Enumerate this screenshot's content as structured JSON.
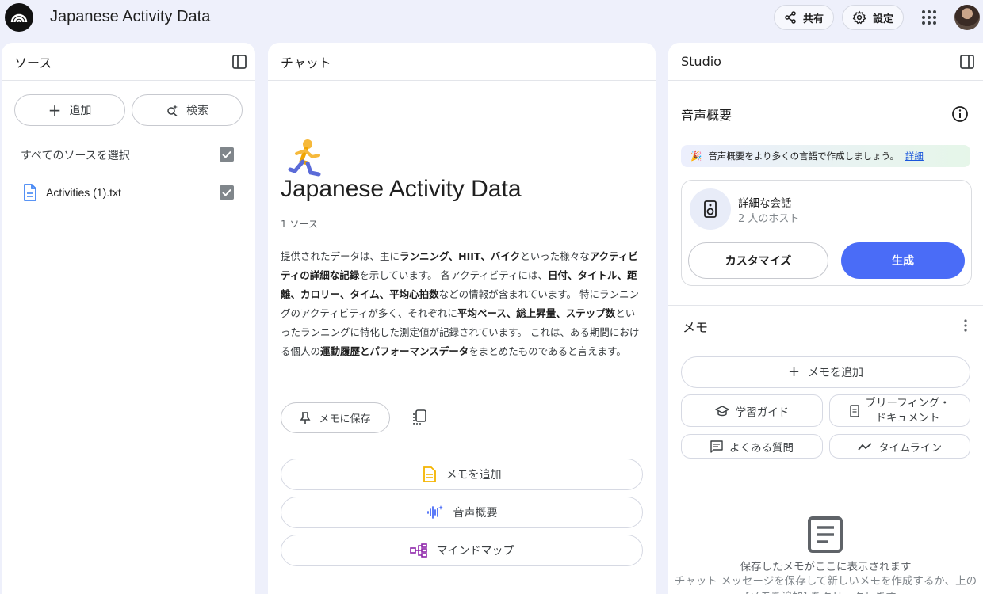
{
  "header": {
    "app_title": "Japanese Activity Data",
    "share_label": "共有",
    "settings_label": "設定"
  },
  "sources": {
    "title": "ソース",
    "add_label": "追加",
    "search_label": "検索",
    "select_all_label": "すべてのソースを選択",
    "items": [
      {
        "label": "Activities (1).txt",
        "checked": true
      }
    ]
  },
  "chat": {
    "title": "チャット",
    "notebook_title": "Japanese Activity Data",
    "source_count": "1 ソース",
    "summary_parts": [
      "提供されたデータは、主に",
      "ランニング、HIIT、バイク",
      "といった様々な",
      "アクティビティの詳細な記録",
      "を示しています。 各アクティビティには、",
      "日付、タイトル、距離、カロリー、タイム、平均心拍数",
      "などの情報が含まれています。 特にランニングのアクティビティが多く、それぞれに",
      "平均ペース、総上昇量、ステップ数",
      "といったランニングに特化した測定値が記録されています。 これは、ある期間における個人の",
      "運動履歴とパフォーマンスデータ",
      "をまとめたものであると言えます。"
    ],
    "save_memo_label": "メモに保存",
    "actions": [
      {
        "label": "メモを追加",
        "icon": "document-icon"
      },
      {
        "label": "音声概要",
        "icon": "audio-sparkle-icon"
      },
      {
        "label": "マインドマップ",
        "icon": "mindmap-icon"
      }
    ]
  },
  "studio": {
    "title": "Studio",
    "audio_overview_title": "音声概要",
    "banner_text": "音声概要をより多くの言語で作成しましょう。",
    "banner_link": "詳細",
    "card_title": "詳細な会話",
    "card_subtitle": "2 人のホスト",
    "customize_label": "カスタマイズ",
    "generate_label": "生成",
    "memo_title": "メモ",
    "memo_add_label": "メモを追加",
    "chips": {
      "study_guide": "学習ガイド",
      "briefing_line1": "ブリーフィング・",
      "briefing_line2": "ドキュメント",
      "faq": "よくある質問",
      "timeline": "タイムライン"
    },
    "empty_title": "保存したメモがここに表示されます",
    "empty_subtitle": "チャット メッセージを保存して新しいメモを作成するか、上の [メモを追加] をクリックします。"
  },
  "colors": {
    "accent": "#4a6cf7",
    "background": "#eef0fb",
    "banner_link": "#1a56db"
  }
}
